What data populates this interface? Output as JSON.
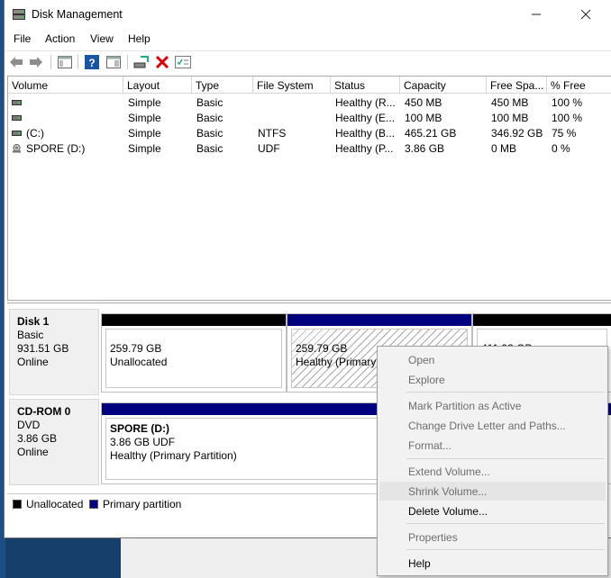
{
  "window": {
    "title": "Disk Management"
  },
  "menu": [
    "File",
    "Action",
    "View",
    "Help"
  ],
  "volume_list": {
    "columns": [
      "Volume",
      "Layout",
      "Type",
      "File System",
      "Status",
      "Capacity",
      "Free Spa...",
      "% Free"
    ],
    "rows": [
      {
        "volume": "",
        "layout": "Simple",
        "type": "Basic",
        "fs": "",
        "status": "Healthy (R...",
        "capacity": "450 MB",
        "free": "450 MB",
        "pct": "100 %"
      },
      {
        "volume": "",
        "layout": "Simple",
        "type": "Basic",
        "fs": "",
        "status": "Healthy (E...",
        "capacity": "100 MB",
        "free": "100 MB",
        "pct": "100 %"
      },
      {
        "volume": "(C:)",
        "layout": "Simple",
        "type": "Basic",
        "fs": "NTFS",
        "status": "Healthy (B...",
        "capacity": "465.21 GB",
        "free": "346.92 GB",
        "pct": "75 %"
      },
      {
        "volume": "SPORE (D:)",
        "layout": "Simple",
        "type": "Basic",
        "fs": "UDF",
        "status": "Healthy (P...",
        "capacity": "3.86 GB",
        "free": "0 MB",
        "pct": "0 %"
      }
    ]
  },
  "disks": {
    "disk1": {
      "name": "Disk 1",
      "type": "Basic",
      "size": "931.51 GB",
      "state": "Online"
    },
    "cdrom0": {
      "name": "CD-ROM 0",
      "type": "DVD",
      "size": "3.86 GB",
      "state": "Online"
    }
  },
  "partitions": {
    "unallocated": {
      "size": "259.79 GB",
      "label": "Unallocated"
    },
    "selected": {
      "size": "259.79 GB",
      "status": "Healthy (Primary P"
    },
    "third": {
      "size": "411.93 GB"
    },
    "spore": {
      "name": "SPORE  (D:)",
      "size": "3.86 GB UDF",
      "status": "Healthy (Primary Partition)"
    }
  },
  "legend": {
    "unallocated": "Unallocated",
    "primary": "Primary partition"
  },
  "context_menu": {
    "open": "Open",
    "explore": "Explore",
    "mark_active": "Mark Partition as Active",
    "change_letter": "Change Drive Letter and Paths...",
    "format": "Format...",
    "extend": "Extend Volume...",
    "shrink": "Shrink Volume...",
    "delete": "Delete Volume...",
    "properties": "Properties",
    "help": "Help"
  },
  "colors": {
    "unallocated": "#000000",
    "primary": "#00007f",
    "hover": "#e5e5e5"
  }
}
